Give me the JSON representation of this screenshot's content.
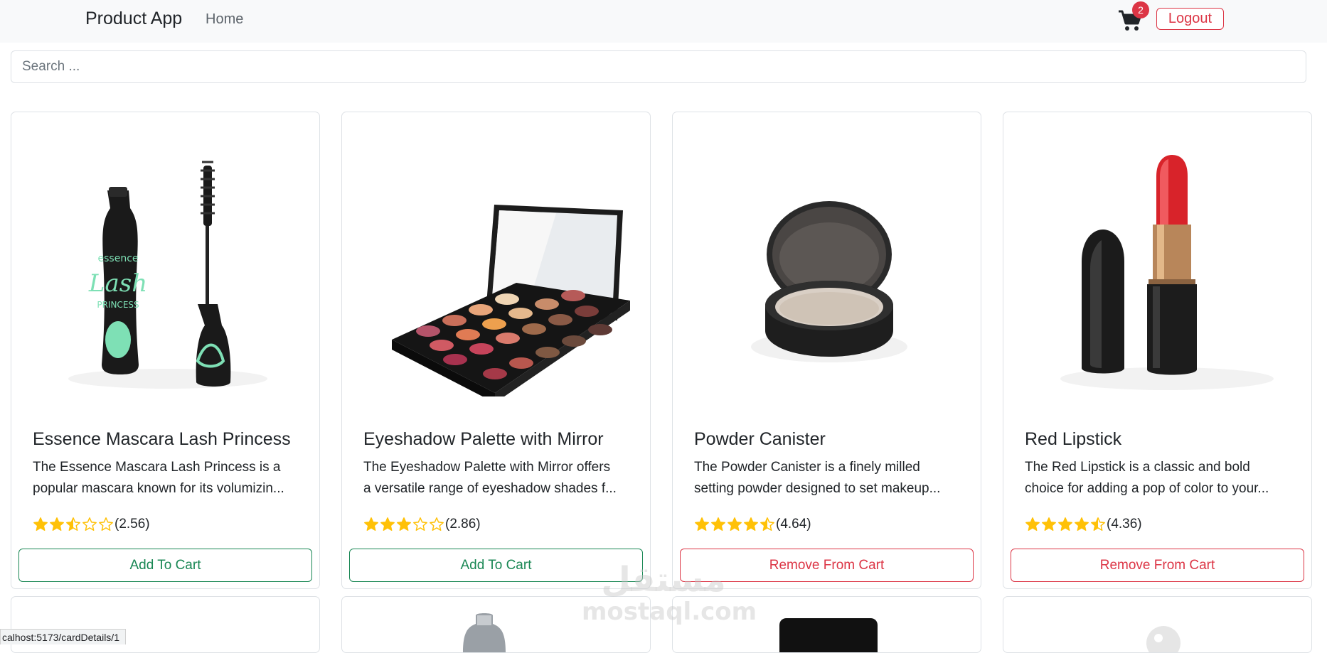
{
  "navbar": {
    "brand": "Product App",
    "home_label": "Home",
    "cart_count": "2",
    "logout_label": "Logout"
  },
  "search": {
    "placeholder": "Search ..."
  },
  "products": [
    {
      "title": "Essence Mascara Lash Princess",
      "desc_line1": "The Essence Mascara Lash Princess is a",
      "desc_line2": "popular mascara known for its volumizin...",
      "rating": 2.56,
      "rating_text": "(2.56)",
      "button_label": "Add To Cart",
      "in_cart": false
    },
    {
      "title": "Eyeshadow Palette with Mirror",
      "desc_line1": "The Eyeshadow Palette with Mirror offers",
      "desc_line2": "a versatile range of eyeshadow shades f...",
      "rating": 2.86,
      "rating_text": "(2.86)",
      "button_label": "Add To Cart",
      "in_cart": false
    },
    {
      "title": "Powder Canister",
      "desc_line1": "The Powder Canister is a finely milled",
      "desc_line2": "setting powder designed to set makeup...",
      "rating": 4.64,
      "rating_text": "(4.64)",
      "button_label": "Remove From Cart",
      "in_cart": true
    },
    {
      "title": "Red Lipstick",
      "desc_line1": "The Red Lipstick is a classic and bold",
      "desc_line2": "choice for adding a pop of color to your...",
      "rating": 4.36,
      "rating_text": "(4.36)",
      "button_label": "Remove From Cart",
      "in_cart": true
    }
  ],
  "product_image_text": {
    "mascara_brand": "essence",
    "mascara_name": "Lash",
    "mascara_sub": "PRINCESS"
  },
  "status_bar": {
    "url": "calhost:5173/cardDetails/1"
  },
  "watermark": {
    "arabic": "مستقل",
    "latin": "mostaql.com"
  },
  "colors": {
    "navbar_bg": "#f8f9fa",
    "success": "#198754",
    "danger": "#dc3545",
    "star": "#ffc107",
    "border": "#dee2e6"
  }
}
